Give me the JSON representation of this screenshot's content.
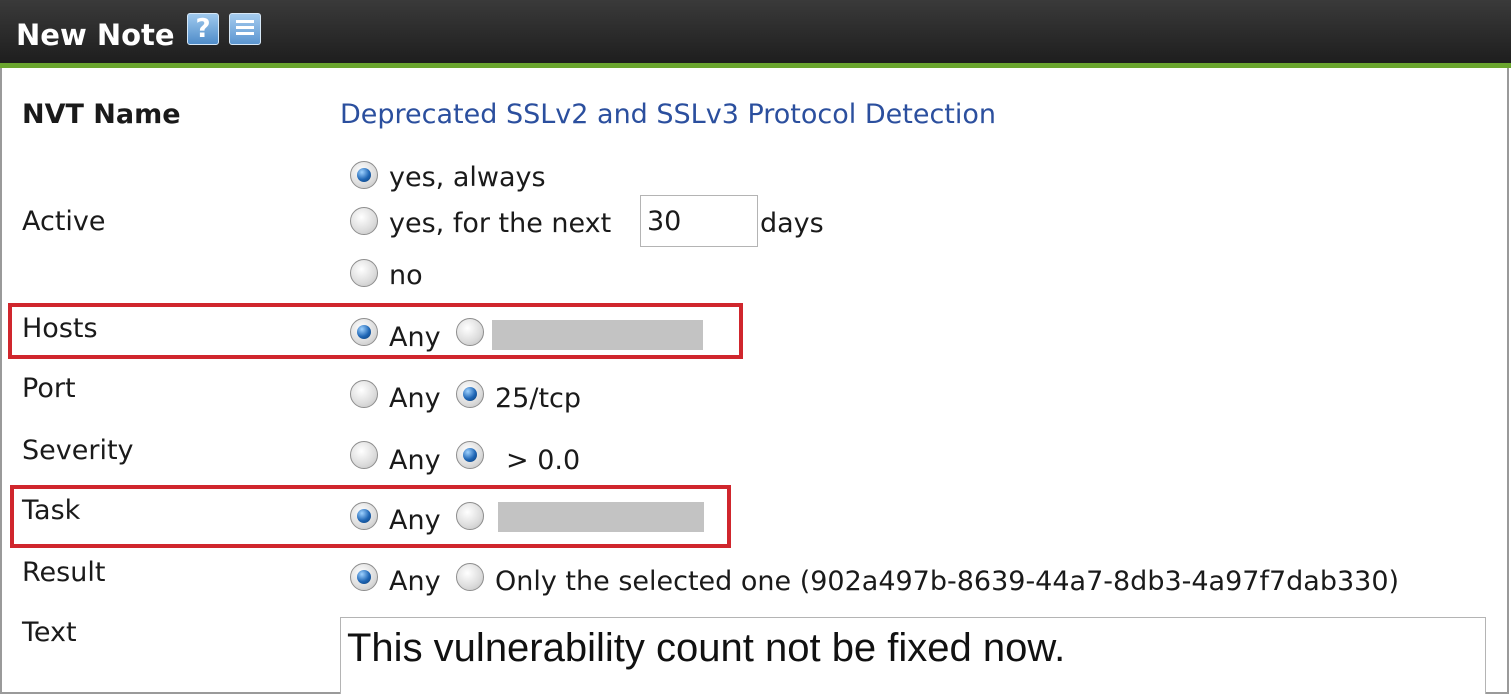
{
  "dialog": {
    "title": "New Note",
    "icons": {
      "help": "help-icon",
      "list": "list-icon"
    }
  },
  "form": {
    "nvt_name": {
      "label": "NVT Name",
      "value": "Deprecated SSLv2 and SSLv3 Protocol Detection"
    },
    "active": {
      "label": "Active",
      "options": [
        "yes, always",
        "yes, for the next",
        "no"
      ],
      "selected": "yes, always",
      "days_value": "30",
      "days_suffix": "days"
    },
    "hosts": {
      "label": "Hosts",
      "any": "Any",
      "selected": "Any"
    },
    "port": {
      "label": "Port",
      "any": "Any",
      "specific": "25/tcp",
      "selected": "25/tcp"
    },
    "severity": {
      "label": "Severity",
      "any": "Any",
      "specific": "> 0.0",
      "selected": "> 0.0"
    },
    "task": {
      "label": "Task",
      "any": "Any",
      "selected": "Any"
    },
    "result": {
      "label": "Result",
      "any": "Any",
      "specific": "Only the selected one (902a497b-8639-44a7-8db3-4a97f7dab330)",
      "selected": "Any"
    },
    "text": {
      "label": "Text",
      "value": "This vulnerability count not be fixed now."
    }
  },
  "colors": {
    "header_bg": "#2a2a2a",
    "header_accent": "#6aa52e",
    "link": "#2b4f9e",
    "highlight": "#d0262d",
    "redaction": "#c3c3c3"
  }
}
